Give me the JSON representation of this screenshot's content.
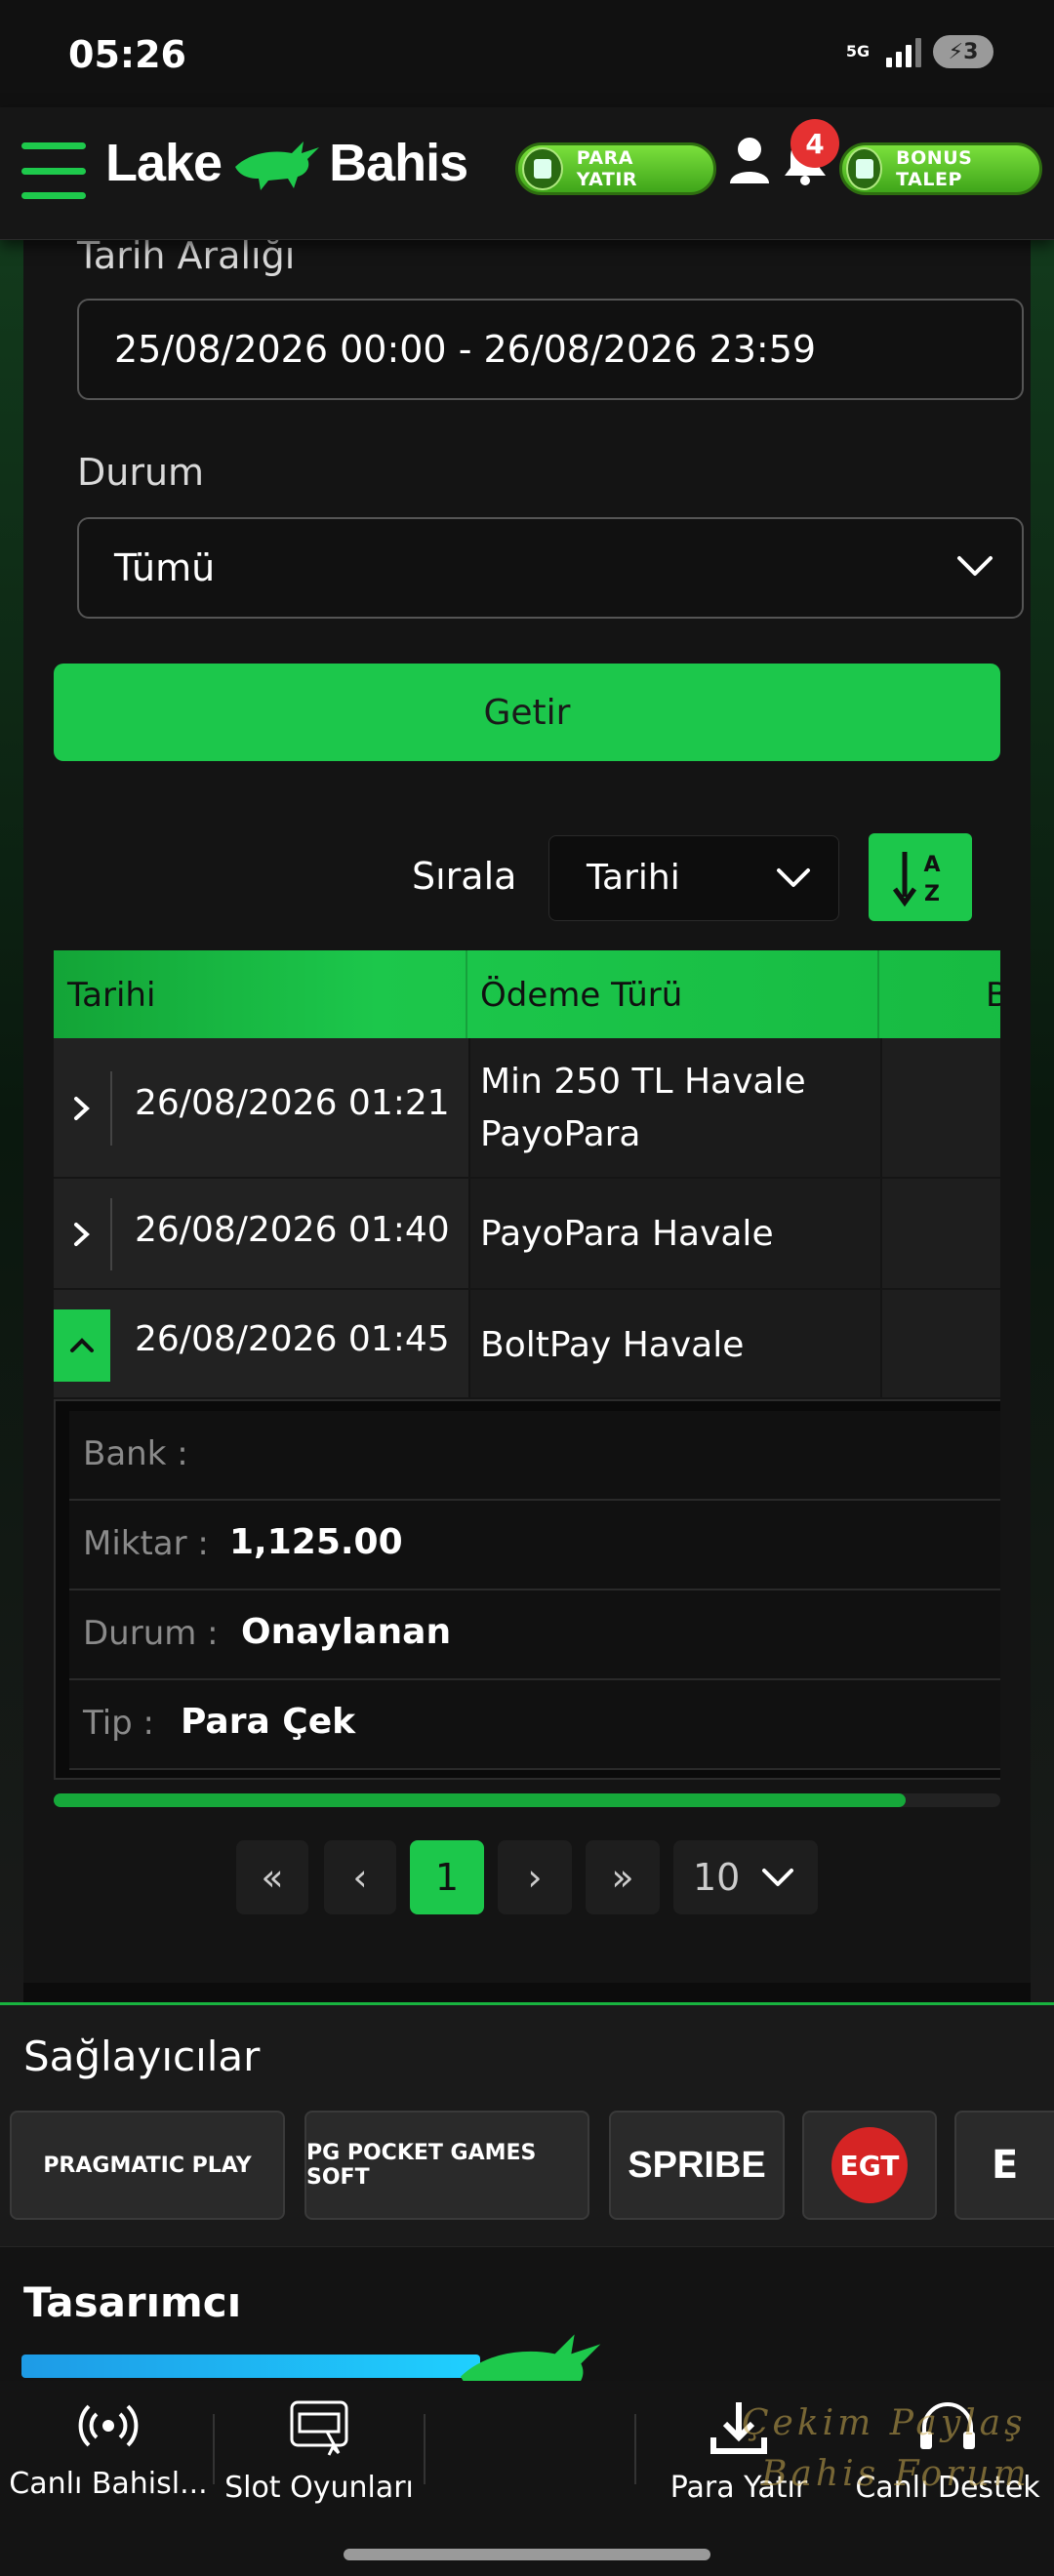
{
  "status_bar": {
    "time": "05:26",
    "network": "5G",
    "battery": "3"
  },
  "header": {
    "logo_left": "Lake",
    "logo_right": "Bahis",
    "deposit_label": "PARA YATIR",
    "bonus_label": "BONUS TALEP",
    "notification_count": "4"
  },
  "filters": {
    "date_range_label": "Tarih Aralığı",
    "date_range_value": "25/08/2026 00:00 - 26/08/2026 23:59",
    "status_label": "Durum",
    "status_value": "Tümü",
    "submit_label": "Getir"
  },
  "sort": {
    "label": "Sırala",
    "value": "Tarihi",
    "az_top": "A",
    "az_bottom": "Z"
  },
  "table": {
    "headers": [
      "Tarihi",
      "Ödeme Türü",
      "B"
    ],
    "rows": [
      {
        "date": "26/08/2026 01:21",
        "payment_line1": "Min 250 TL Havale",
        "payment_line2": "PayoPara",
        "expanded": false
      },
      {
        "date": "26/08/2026 01:40",
        "payment_line1": "PayoPara Havale",
        "payment_line2": "",
        "expanded": false
      },
      {
        "date": "26/08/2026 01:45",
        "payment_line1": "BoltPay Havale",
        "payment_line2": "",
        "expanded": true
      }
    ],
    "detail": {
      "bank_key": "Bank  :",
      "bank_value": "",
      "amount_key": "Miktar :",
      "amount_value": "1,125.00",
      "status_key": "Durum :",
      "status_value": "Onaylanan",
      "type_key": "Tip :",
      "type_value": "Para Çek"
    },
    "scroll_fraction": 0.9
  },
  "pagination": {
    "first": "«",
    "prev": "‹",
    "current": "1",
    "next": "›",
    "last": "»",
    "page_size": "10"
  },
  "providers": {
    "title": "Sağlayıcılar",
    "items": [
      "PRAGMATIC PLAY",
      "PG POCKET GAMES SOFT",
      "SPRIBE",
      "EGT",
      "E"
    ]
  },
  "designer": {
    "title": "Tasarımcı"
  },
  "bottom_nav": {
    "items": [
      "Canlı Bahisl...",
      "Slot Oyunları",
      "",
      "Para Yatır",
      "Canlı Destek"
    ]
  },
  "watermark": {
    "line1": "Çekim Paylaş",
    "line2": "Bahis Forum"
  },
  "colors": {
    "accent": "#1cc74b",
    "background": "#141414",
    "badge": "#e53131"
  }
}
